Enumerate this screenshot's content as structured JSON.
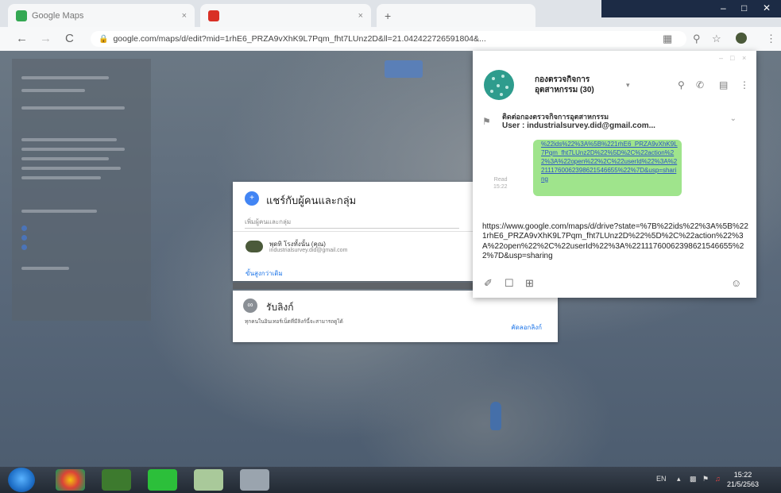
{
  "browser": {
    "tab_title": "Google Maps",
    "tab_close": "×",
    "new_tab": "+",
    "url": "google.com/maps/d/edit?mid=1rhE6_PRZA9vXhK9L7Pqm_fht7LUnz2D&ll=21.042422726591804&...",
    "window_controls": {
      "minimize": "–",
      "maximize": "□",
      "close": "✕"
    },
    "nav": {
      "back": "←",
      "forward": "→",
      "reload": "C"
    }
  },
  "share_dialog": {
    "title": "แชร์กับผู้คนและกลุ่ม",
    "input_placeholder": "เพิ่มผู้คนและกลุ่ม",
    "person_name": "พุดทิ โรงทั้งนั้น (คุณ)",
    "person_email": "industrialsurvey.did@gmail.com",
    "advanced_link": "ขั้นสูงกว่าเดิม"
  },
  "link_card": {
    "title": "รับลิงก์",
    "description": "ทุกคนในอินเทอร์เน็ตที่มีลิงก์นี้จะสามารถดูได้",
    "action": "คัดลอกลิงก์"
  },
  "chat": {
    "group_name": "กองตรวจกิจการอุตสาหกรรม (30)",
    "pinned_title": "ติดต่อกองตรวจกิจการอุตสาหกรรม",
    "pinned_subtitle": "User : industrialsurvey.did@gmail.com...",
    "bubble_text": "%22ids%22%3A%5B%221rhE6_PRZA9vXhK9L7Pqm_fht7LUnz2D%22%5D%2C%22action%22%3A%22open%22%2C%22userId%22%3A%22111760062398621546655%22%7D&usp=sharing",
    "message_time": "Read\n15:22",
    "input_text": "https://www.google.com/maps/d/drive?state=%7B%22ids%22%3A%5B%221rhE6_PRZA9vXhK9L7Pqm_fht7LUnz2D%22%5D%2C%22action%22%3A%22open%22%2C%22userId%22%3A%22111760062398621546655%22%7D&usp=sharing"
  },
  "taskbar": {
    "language": "EN",
    "time": "15:22",
    "date": "21/5/2563"
  },
  "icons": [
    "lock-icon",
    "search-icon",
    "phone-icon",
    "notes-icon",
    "menu-icon",
    "attach-icon",
    "bookmark-icon",
    "crop-icon",
    "emoji-icon",
    "pin-icon"
  ]
}
